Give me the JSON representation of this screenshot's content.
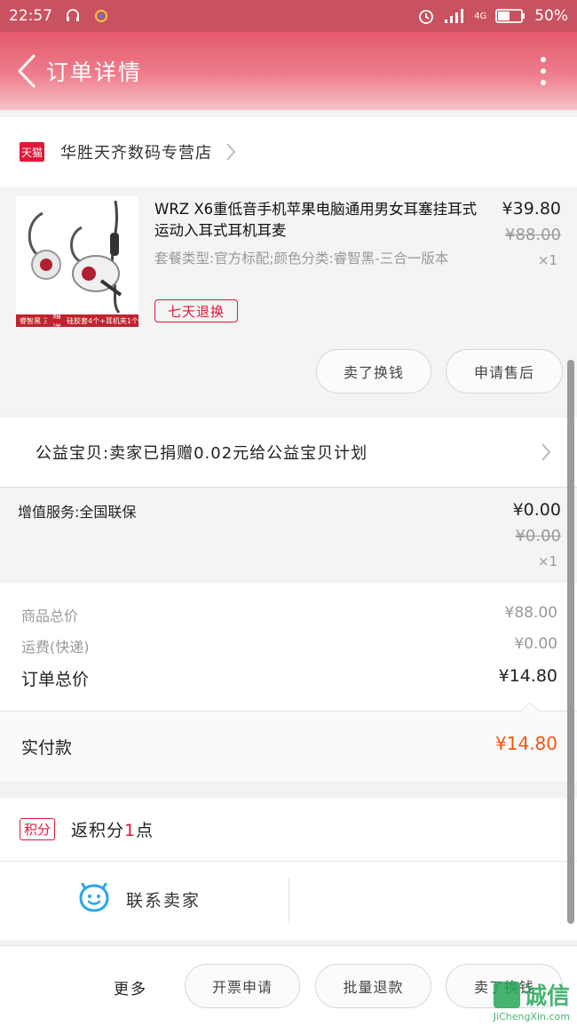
{
  "status_bar": {
    "time": "22:57",
    "signal": "4G",
    "battery": "50%"
  },
  "header": {
    "title": "订单详情"
  },
  "shop": {
    "badge": "天猫",
    "name": "华胜天齐数码专营店"
  },
  "product": {
    "image_strip_left": "睿智黑 三合一版本",
    "image_strip_promo": "赠送",
    "image_strip_right": "硅胶套4个+耳机夹1个",
    "title": "WRZ X6重低音手机苹果电脑通用男女耳塞挂耳式运动入耳式耳机耳麦",
    "sku": "套餐类型:官方标配;颜色分类:睿智黑-三合一版本",
    "return_tag": "七天退换",
    "price": "¥39.80",
    "original_price": "¥88.00",
    "quantity": "×1"
  },
  "product_actions": {
    "sell": "卖了换钱",
    "after_sale": "申请售后"
  },
  "charity": {
    "text": "公益宝贝:卖家已捐赠0.02元给公益宝贝计划"
  },
  "value_added": {
    "label": "增值服务:全国联保",
    "price": "¥0.00",
    "original_price": "¥0.00",
    "quantity": "×1"
  },
  "summary": {
    "goods_total_label": "商品总价",
    "goods_total_value": "¥88.00",
    "shipping_label": "运费(快递)",
    "shipping_value": "¥0.00",
    "order_total_label": "订单总价",
    "order_total_value": "¥14.80"
  },
  "payment": {
    "label": "实付款",
    "amount": "¥14.80"
  },
  "points": {
    "badge": "积分",
    "text_prefix": "返积分",
    "count": "1",
    "unit": "点"
  },
  "contact": {
    "label": "联系卖家"
  },
  "bottom_bar": {
    "more": "更多",
    "invoice": "开票申请",
    "batch_refund": "批量退款",
    "sell": "卖了换钱"
  },
  "watermark": {
    "cn": "诚信",
    "en": "JiChengXin.com"
  },
  "colors": {
    "header": "#e45a6b",
    "accent": "#e4163a",
    "paid": "#f5530f"
  }
}
